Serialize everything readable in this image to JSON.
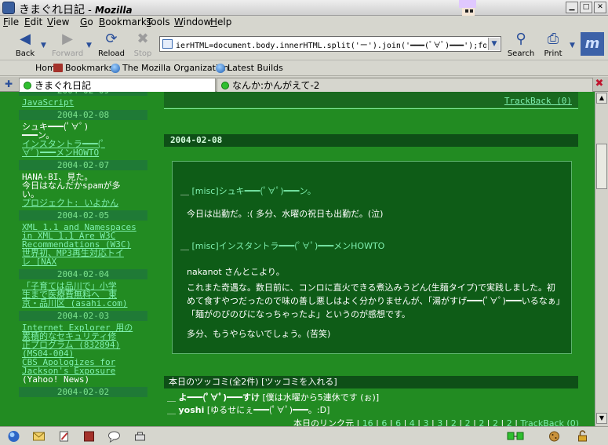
{
  "window": {
    "page_title": "きまぐれ日記",
    "app_name": "Mozilla",
    "title_sep": " - "
  },
  "menu": [
    "File",
    "Edit",
    "View",
    "Go",
    "Bookmarks",
    "Tools",
    "Window",
    "Help"
  ],
  "nav": {
    "back": "Back",
    "forward": "Forward",
    "reload": "Reload",
    "stop": "Stop",
    "search": "Search",
    "print": "Print",
    "url_value": "ierHTML=document.body.innerHTML.split('ー').join('━━━(ﾟ∀ﾟ)━━━');focus();"
  },
  "personal": {
    "home": "Home",
    "bookmarks": "Bookmarks",
    "mozilla_org": "The Mozilla Organization",
    "latest_builds": "Latest Builds"
  },
  "tabs": [
    {
      "label": "きまぐれ日記",
      "active": true
    },
    {
      "label": "なんか:かんがえて-2",
      "active": false
    }
  ],
  "sidebar": [
    {
      "type": "head",
      "text": "2004-02-09"
    },
    {
      "type": "link",
      "text": "JavaScript"
    },
    {
      "type": "head",
      "text": "2004-02-08"
    },
    {
      "type": "text",
      "text": "シュキ━━━(ﾟ∀ﾟ)"
    },
    {
      "type": "text",
      "text": "━━━ン。"
    },
    {
      "type": "link",
      "text": "インスタントラ━━━(ﾟ"
    },
    {
      "type": "link",
      "text": "∀ﾟ)━━━メンHOWTO"
    },
    {
      "type": "head",
      "text": "2004-02-07"
    },
    {
      "type": "text",
      "text": "HANA-BI、見た。"
    },
    {
      "type": "text",
      "text": "今日はなんだかspamが多"
    },
    {
      "type": "text",
      "text": "い。"
    },
    {
      "type": "link",
      "text": "プロジェクト: いよかん"
    },
    {
      "type": "head",
      "text": "2004-02-05"
    },
    {
      "type": "link",
      "text": "XML 1.1 and Namespaces"
    },
    {
      "type": "link",
      "text": "in XML 1.1 Are W3C"
    },
    {
      "type": "link",
      "text": "Recommendations (W3C)"
    },
    {
      "type": "link",
      "text": "世界初、MP3再生対応トイ"
    },
    {
      "type": "link",
      "text": "レ [NAX"
    },
    {
      "type": "head",
      "text": "2004-02-04"
    },
    {
      "type": "link",
      "text": "「子育ては品川で」小学"
    },
    {
      "type": "link",
      "text": "生まで医療費無料へ　東"
    },
    {
      "type": "link",
      "text": "京・品川区 (asahi.com)"
    },
    {
      "type": "head",
      "text": "2004-02-03"
    },
    {
      "type": "link",
      "text": "Internet Explorer 用の"
    },
    {
      "type": "link",
      "text": "累積的なセキュリティ修"
    },
    {
      "type": "link",
      "text": "正プログラム (832894)"
    },
    {
      "type": "link",
      "text": "(MS04-004)"
    },
    {
      "type": "link",
      "text": "CBS Apologizes for"
    },
    {
      "type": "link",
      "text": "Jackson's Exposure"
    },
    {
      "type": "text",
      "text": "(Yahoo! News)"
    },
    {
      "type": "head",
      "text": "2004-02-02"
    }
  ],
  "main": {
    "trackback_top": "TrackBack (0)",
    "date": "2004-02-08",
    "entry_title_1": "[misc]シュキ━━━(ﾟ∀ﾟ)━━━ン。",
    "entry_p1": "今日は出勤だ。:( 多分、水曜の祝日も出勤だ。(泣)",
    "entry_title_2": "[misc]インスタントラ━━━(ﾟ∀ﾟ)━━━メンHOWTO",
    "entry_p2": "nakanot さんとこより。",
    "entry_p3": "これまた奇遇な。数日前に、コンロに直火できる煮込みうどん(生麺タイプ)で実践しました。初めて食すやつだったので味の善し悪しはよく分かりませんが、「湯がすげ━━━(ﾟ∀ﾟ)━━━いるなぁ」「麺がのびのびになっちゃったよ」というのが感想です。",
    "entry_p4": "多分、もうやらないでしょう。(苦笑)",
    "tsukkomi_header": "本日のツッコミ(全2件) [ツッコミを入れる]",
    "comments": [
      {
        "name": "よ━━━(ﾟ∀ﾟ)━━━すけ",
        "text": "[僕は水曜から5連休です (ぉ)]"
      },
      {
        "name": "yoshi",
        "text": "[ゆるせにぇ━━━(ﾟ∀ﾟ)━━━。:D]"
      }
    ],
    "links_prefix": "本日のリンク元 |",
    "links": [
      "16",
      "6",
      "6",
      "4",
      "3",
      "3",
      "2",
      "2",
      "2",
      "2",
      "2"
    ],
    "trackback_bottom": "TrackBack (0)"
  },
  "colors": {
    "page_bg": "#228b22",
    "link": "#7ff0b0",
    "dark_box": "#0e5c17"
  }
}
